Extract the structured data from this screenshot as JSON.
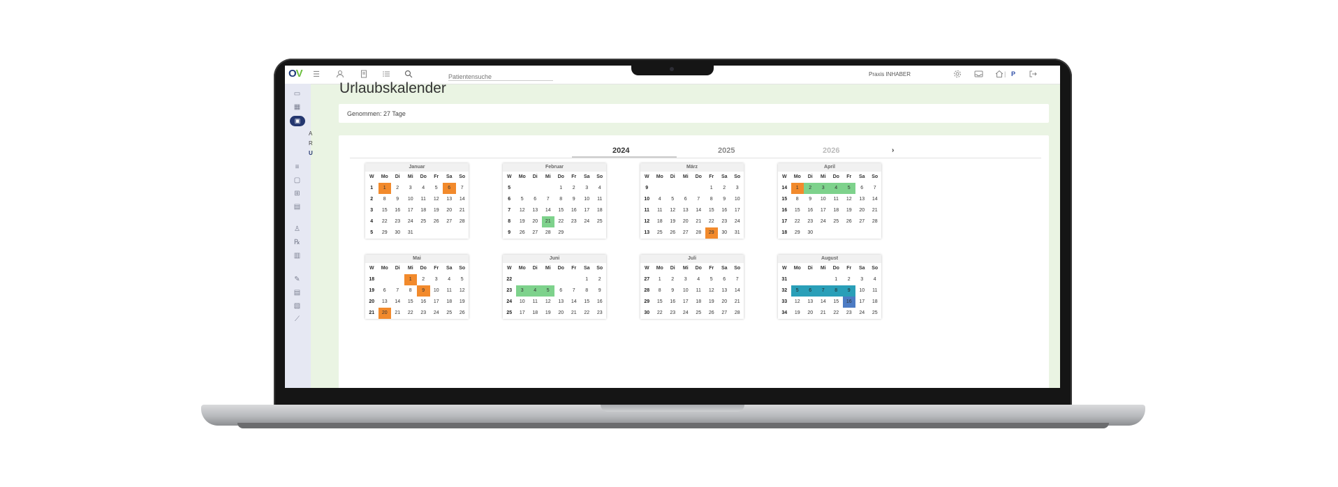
{
  "topbar": {
    "search_placeholder": "Patientensuche",
    "praxis_label": "Praxis INHABER",
    "user_initial": "P",
    "separator": "|"
  },
  "sidebar": {
    "letters": [
      "A",
      "R",
      "U"
    ]
  },
  "page": {
    "title": "Urlaubskalender",
    "summary": "Genommen: 27 Tage"
  },
  "years": {
    "tabs": [
      "2024",
      "2025",
      "2026"
    ],
    "active": "2024",
    "next_icon": "chevron-right-icon"
  },
  "weekday_header": [
    "W",
    "Mo",
    "Di",
    "Mi",
    "Do",
    "Fr",
    "Sa",
    "So"
  ],
  "colors": {
    "orange": "#f28a2c",
    "green": "#7ed28c",
    "teal": "#2a9fb8",
    "blue": "#4d7cc4"
  },
  "months": [
    {
      "name": "Januar",
      "weeks": [
        {
          "w": "1",
          "days": [
            "",
            "1",
            "2",
            "3",
            "4",
            "5",
            "6",
            "7"
          ],
          "hl": {
            "1": "o",
            "6": "o"
          }
        },
        {
          "w": "2",
          "days": [
            "",
            "8",
            "9",
            "10",
            "11",
            "12",
            "13",
            "14"
          ]
        },
        {
          "w": "3",
          "days": [
            "",
            "15",
            "16",
            "17",
            "18",
            "19",
            "20",
            "21"
          ]
        },
        {
          "w": "4",
          "days": [
            "",
            "22",
            "23",
            "24",
            "25",
            "26",
            "27",
            "28"
          ]
        },
        {
          "w": "5",
          "days": [
            "",
            "29",
            "30",
            "31",
            "",
            "",
            "",
            ""
          ]
        }
      ]
    },
    {
      "name": "Februar",
      "weeks": [
        {
          "w": "5",
          "days": [
            "",
            "",
            "",
            "",
            "1",
            "2",
            "3",
            "4"
          ]
        },
        {
          "w": "6",
          "days": [
            "",
            "5",
            "6",
            "7",
            "8",
            "9",
            "10",
            "11"
          ]
        },
        {
          "w": "7",
          "days": [
            "",
            "12",
            "13",
            "14",
            "15",
            "16",
            "17",
            "18"
          ]
        },
        {
          "w": "8",
          "days": [
            "",
            "19",
            "20",
            "21",
            "22",
            "23",
            "24",
            "25"
          ],
          "hl": {
            "3": "g"
          }
        },
        {
          "w": "9",
          "days": [
            "",
            "26",
            "27",
            "28",
            "29",
            "",
            "",
            ""
          ]
        }
      ]
    },
    {
      "name": "März",
      "weeks": [
        {
          "w": "9",
          "days": [
            "",
            "",
            "",
            "",
            "",
            "1",
            "2",
            "3"
          ]
        },
        {
          "w": "10",
          "days": [
            "",
            "4",
            "5",
            "6",
            "7",
            "8",
            "9",
            "10"
          ]
        },
        {
          "w": "11",
          "days": [
            "",
            "11",
            "12",
            "13",
            "14",
            "15",
            "16",
            "17"
          ]
        },
        {
          "w": "12",
          "days": [
            "",
            "18",
            "19",
            "20",
            "21",
            "22",
            "23",
            "24"
          ]
        },
        {
          "w": "13",
          "days": [
            "",
            "25",
            "26",
            "27",
            "28",
            "29",
            "30",
            "31"
          ],
          "hl": {
            "5": "o"
          }
        }
      ]
    },
    {
      "name": "April",
      "weeks": [
        {
          "w": "14",
          "days": [
            "",
            "1",
            "2",
            "3",
            "4",
            "5",
            "6",
            "7"
          ],
          "hl": {
            "1": "o",
            "2": "g",
            "3": "g",
            "4": "g",
            "5": "g"
          }
        },
        {
          "w": "15",
          "days": [
            "",
            "8",
            "9",
            "10",
            "11",
            "12",
            "13",
            "14"
          ]
        },
        {
          "w": "16",
          "days": [
            "",
            "15",
            "16",
            "17",
            "18",
            "19",
            "20",
            "21"
          ]
        },
        {
          "w": "17",
          "days": [
            "",
            "22",
            "23",
            "24",
            "25",
            "26",
            "27",
            "28"
          ]
        },
        {
          "w": "18",
          "days": [
            "",
            "29",
            "30",
            "",
            "",
            "",
            "",
            ""
          ]
        }
      ]
    },
    {
      "name": "Mai",
      "weeks": [
        {
          "w": "18",
          "days": [
            "",
            "",
            "",
            "1",
            "2",
            "3",
            "4",
            "5"
          ],
          "hl": {
            "3": "o"
          }
        },
        {
          "w": "19",
          "days": [
            "",
            "6",
            "7",
            "8",
            "9",
            "10",
            "11",
            "12"
          ],
          "hl": {
            "4": "o"
          }
        },
        {
          "w": "20",
          "days": [
            "",
            "13",
            "14",
            "15",
            "16",
            "17",
            "18",
            "19"
          ]
        },
        {
          "w": "21",
          "days": [
            "",
            "20",
            "21",
            "22",
            "23",
            "24",
            "25",
            "26"
          ],
          "hl": {
            "1": "o"
          }
        }
      ]
    },
    {
      "name": "Juni",
      "weeks": [
        {
          "w": "22",
          "days": [
            "",
            "",
            "",
            "",
            "",
            "",
            "1",
            "2"
          ]
        },
        {
          "w": "23",
          "days": [
            "",
            "3",
            "4",
            "5",
            "6",
            "7",
            "8",
            "9"
          ],
          "hl": {
            "1": "g",
            "2": "g",
            "3": "g"
          }
        },
        {
          "w": "24",
          "days": [
            "",
            "10",
            "11",
            "12",
            "13",
            "14",
            "15",
            "16"
          ]
        },
        {
          "w": "25",
          "days": [
            "",
            "17",
            "18",
            "19",
            "20",
            "21",
            "22",
            "23"
          ]
        }
      ]
    },
    {
      "name": "Juli",
      "weeks": [
        {
          "w": "27",
          "days": [
            "",
            "1",
            "2",
            "3",
            "4",
            "5",
            "6",
            "7"
          ]
        },
        {
          "w": "28",
          "days": [
            "",
            "8",
            "9",
            "10",
            "11",
            "12",
            "13",
            "14"
          ]
        },
        {
          "w": "29",
          "days": [
            "",
            "15",
            "16",
            "17",
            "18",
            "19",
            "20",
            "21"
          ]
        },
        {
          "w": "30",
          "days": [
            "",
            "22",
            "23",
            "24",
            "25",
            "26",
            "27",
            "28"
          ]
        }
      ]
    },
    {
      "name": "August",
      "weeks": [
        {
          "w": "31",
          "days": [
            "",
            "",
            "",
            "",
            "1",
            "2",
            "3",
            "4"
          ]
        },
        {
          "w": "32",
          "days": [
            "",
            "5",
            "6",
            "7",
            "8",
            "9",
            "10",
            "11"
          ],
          "hl": {
            "1": "t",
            "2": "t",
            "3": "t",
            "4": "t",
            "5": "t"
          }
        },
        {
          "w": "33",
          "days": [
            "",
            "12",
            "13",
            "14",
            "15",
            "16",
            "17",
            "18"
          ],
          "hl": {
            "5": "b"
          }
        },
        {
          "w": "34",
          "days": [
            "",
            "19",
            "20",
            "21",
            "22",
            "23",
            "24",
            "25"
          ]
        }
      ]
    }
  ]
}
